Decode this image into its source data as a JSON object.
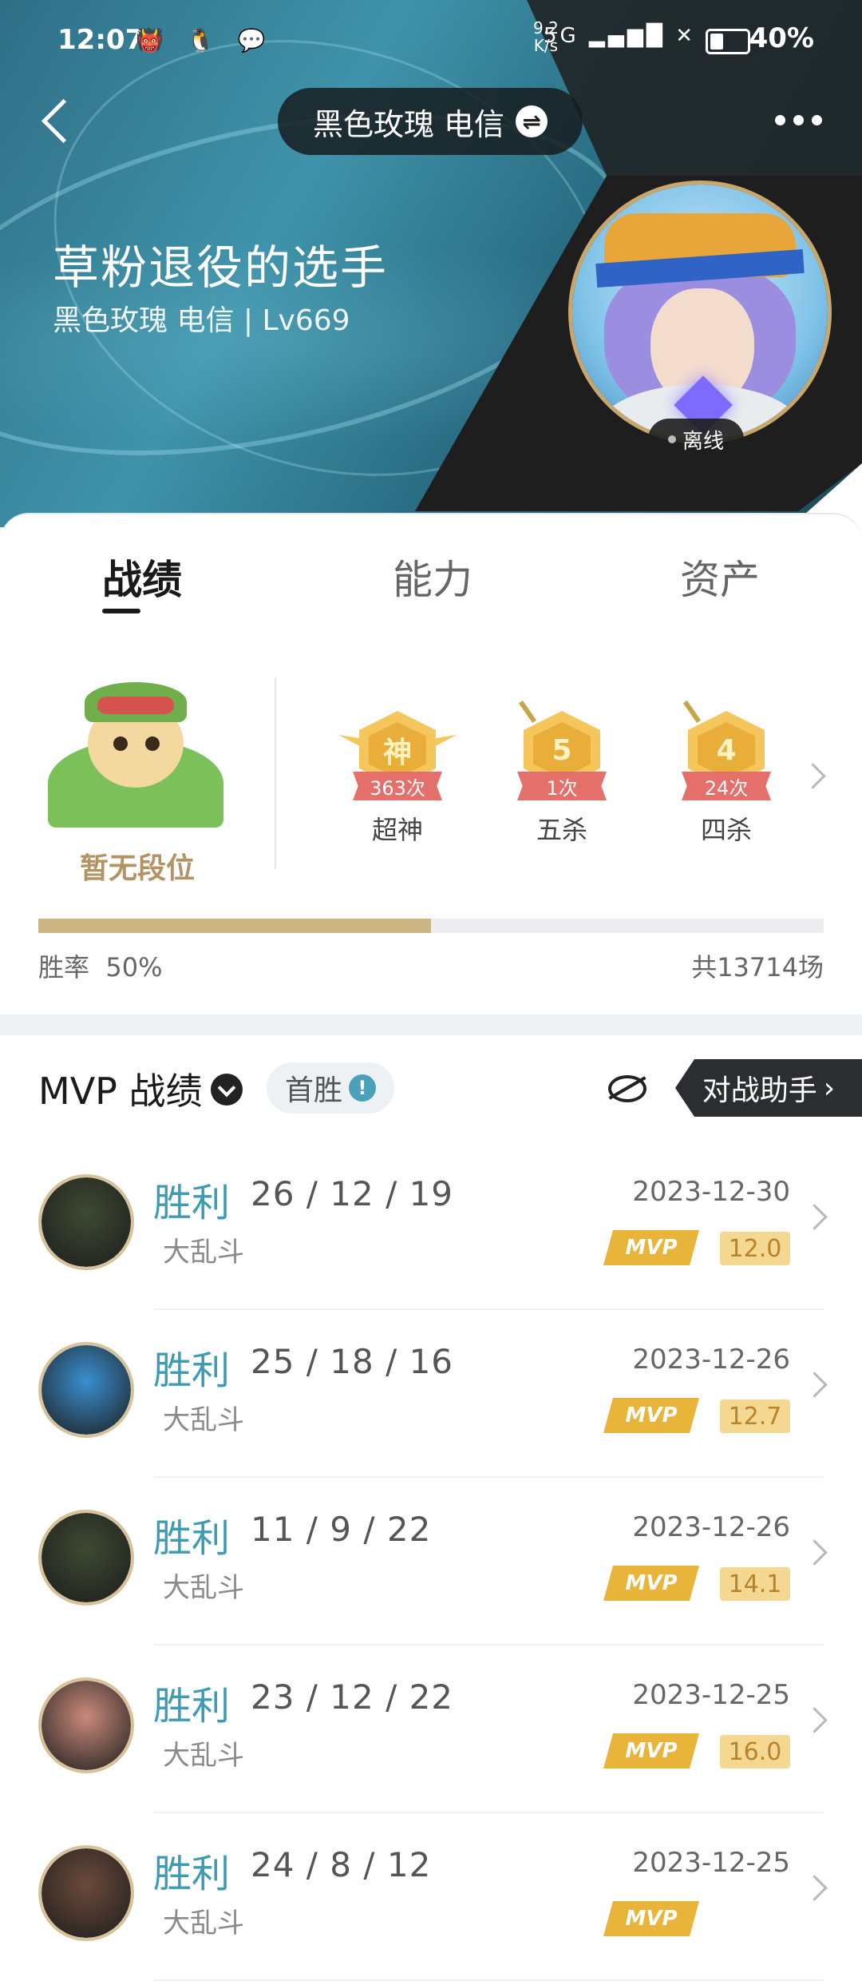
{
  "status_bar": {
    "time": "12:07",
    "left_icons": "👹 🐧 💬",
    "net_speed_top": "9.2",
    "net_speed_bottom": "K/s",
    "signal": "5G ▂▄▆█ ✕",
    "battery": "40%"
  },
  "nav": {
    "server_name": "黑色玫瑰 电信",
    "swap_icon": "⇌"
  },
  "profile": {
    "nickname": "草粉退役的选手",
    "server_level": "黑色玫瑰 电信 | Lv669",
    "status": "离线"
  },
  "tabs": [
    "战绩",
    "能力",
    "资产"
  ],
  "rank": {
    "label": "暂无段位",
    "medals": [
      {
        "glyph": "神",
        "count": "363次",
        "name": "超神"
      },
      {
        "glyph": "5",
        "count": "1次",
        "name": "五杀"
      },
      {
        "glyph": "4",
        "count": "24次",
        "name": "四杀"
      }
    ],
    "win_rate_label": "胜率",
    "win_rate_value": "50%",
    "win_rate": 0.5,
    "total_games": "共13714场"
  },
  "mvp": {
    "title": "MVP 战绩",
    "first_win": "首胜",
    "info_icon": "!",
    "assist_label": "对战助手",
    "assist_arrow": "›"
  },
  "colors": {
    "accent_teal": "#3d9cb4",
    "gold": "#e9b43a",
    "rank_gold": "#b39363"
  },
  "matches": [
    {
      "result": "胜利",
      "kda": "26 / 12 / 19",
      "mode": "大乱斗",
      "date": "2023-12-30",
      "badge": "MVP",
      "score": "12.0",
      "hero_color": "#3d4a32"
    },
    {
      "result": "胜利",
      "kda": "25 / 18 / 16",
      "mode": "大乱斗",
      "date": "2023-12-26",
      "badge": "MVP",
      "score": "12.7",
      "hero_color": "#3a8fd0"
    },
    {
      "result": "胜利",
      "kda": "11 / 9 / 22",
      "mode": "大乱斗",
      "date": "2023-12-26",
      "badge": "MVP",
      "score": "14.1",
      "hero_color": "#3d4a32"
    },
    {
      "result": "胜利",
      "kda": "23 / 12 / 22",
      "mode": "大乱斗",
      "date": "2023-12-25",
      "badge": "MVP",
      "score": "16.0",
      "hero_color": "#c98a7a"
    },
    {
      "result": "胜利",
      "kda": "24 / 8 / 12",
      "mode": "大乱斗",
      "date": "2023-12-25",
      "badge": "MVP",
      "score": "",
      "hero_color": "#6b4a3a"
    }
  ]
}
